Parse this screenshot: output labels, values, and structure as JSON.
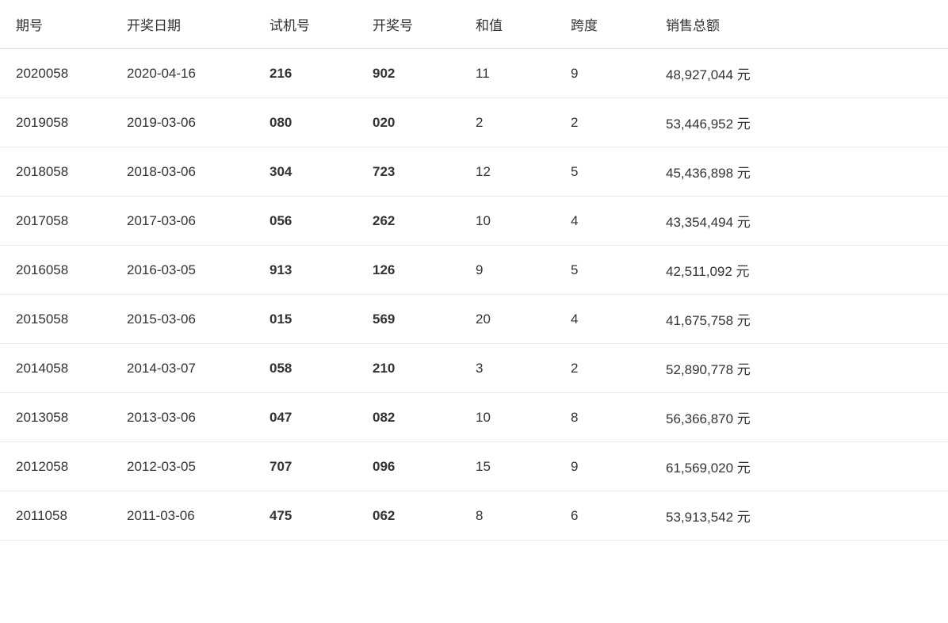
{
  "table": {
    "headers": [
      "期号",
      "开奖日期",
      "试机号",
      "开奖号",
      "和值",
      "跨度",
      "销售总额"
    ],
    "rows": [
      {
        "qihao": "2020058",
        "date": "2020-04-16",
        "shiji": "216",
        "kaij": "902",
        "hezhi": "11",
        "kuadu": "9",
        "sale": "48,927,044 元"
      },
      {
        "qihao": "2019058",
        "date": "2019-03-06",
        "shiji": "080",
        "kaij": "020",
        "hezhi": "2",
        "kuadu": "2",
        "sale": "53,446,952 元"
      },
      {
        "qihao": "2018058",
        "date": "2018-03-06",
        "shiji": "304",
        "kaij": "723",
        "hezhi": "12",
        "kuadu": "5",
        "sale": "45,436,898 元"
      },
      {
        "qihao": "2017058",
        "date": "2017-03-06",
        "shiji": "056",
        "kaij": "262",
        "hezhi": "10",
        "kuadu": "4",
        "sale": "43,354,494 元"
      },
      {
        "qihao": "2016058",
        "date": "2016-03-05",
        "shiji": "913",
        "kaij": "126",
        "hezhi": "9",
        "kuadu": "5",
        "sale": "42,511,092 元"
      },
      {
        "qihao": "2015058",
        "date": "2015-03-06",
        "shiji": "015",
        "kaij": "569",
        "hezhi": "20",
        "kuadu": "4",
        "sale": "41,675,758 元"
      },
      {
        "qihao": "2014058",
        "date": "2014-03-07",
        "shiji": "058",
        "kaij": "210",
        "hezhi": "3",
        "kuadu": "2",
        "sale": "52,890,778 元"
      },
      {
        "qihao": "2013058",
        "date": "2013-03-06",
        "shiji": "047",
        "kaij": "082",
        "hezhi": "10",
        "kuadu": "8",
        "sale": "56,366,870 元"
      },
      {
        "qihao": "2012058",
        "date": "2012-03-05",
        "shiji": "707",
        "kaij": "096",
        "hezhi": "15",
        "kuadu": "9",
        "sale": "61,569,020 元"
      },
      {
        "qihao": "2011058",
        "date": "2011-03-06",
        "shiji": "475",
        "kaij": "062",
        "hezhi": "8",
        "kuadu": "6",
        "sale": "53,913,542 元"
      }
    ]
  }
}
